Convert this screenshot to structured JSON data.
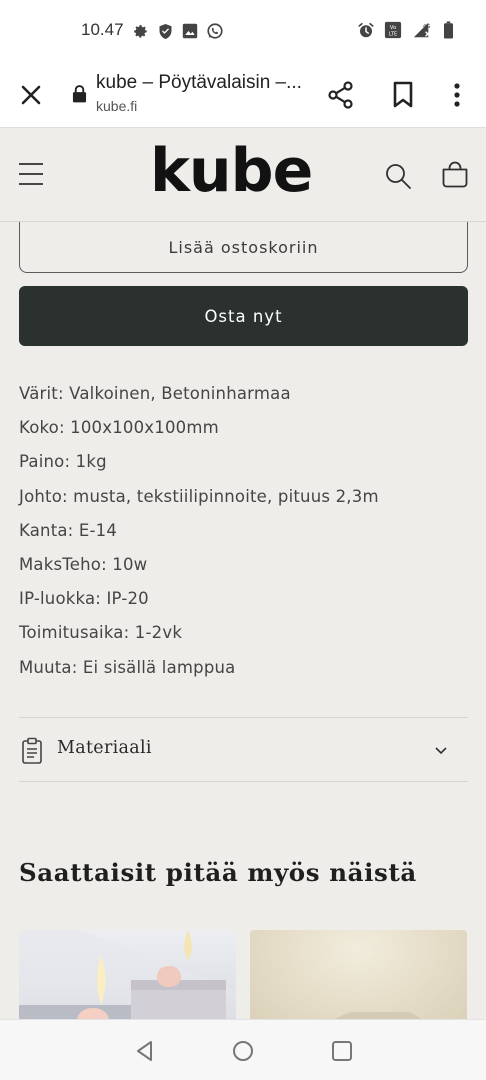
{
  "status_bar": {
    "time": "10.47",
    "left_icons": [
      "gear-icon",
      "shield-icon",
      "image-icon",
      "whatsapp-icon"
    ],
    "right_icons": [
      "alarm-icon",
      "volte-icon",
      "signal-4g-icon",
      "battery-icon"
    ],
    "signal_label": "4G"
  },
  "browser": {
    "title": "kube – Pöytävalaisin –...",
    "url": "kube.fi"
  },
  "site": {
    "logo": "kube"
  },
  "product": {
    "add_to_cart_label": "Lisää ostoskoriin",
    "buy_now_label": "Osta nyt",
    "specs": [
      "Värit: Valkoinen, Betoninharmaa",
      "Koko: 100x100x100mm",
      "Paino: 1kg",
      "Johto: musta, tekstiilipinnoite, pituus 2,3m",
      "Kanta: E-14",
      "MaksTeho: 10w",
      "IP-luokka: IP-20",
      "Toimitusaika: 1-2vk",
      "Muuta: Ei sisällä lamppua"
    ],
    "accordion_label": "Materiaali"
  },
  "recommendations": {
    "title": "Saattaisit pitää myös näistä"
  },
  "colors": {
    "background": "#efedea",
    "primary_button": "#2b312e",
    "text": "#3b3b3b"
  }
}
